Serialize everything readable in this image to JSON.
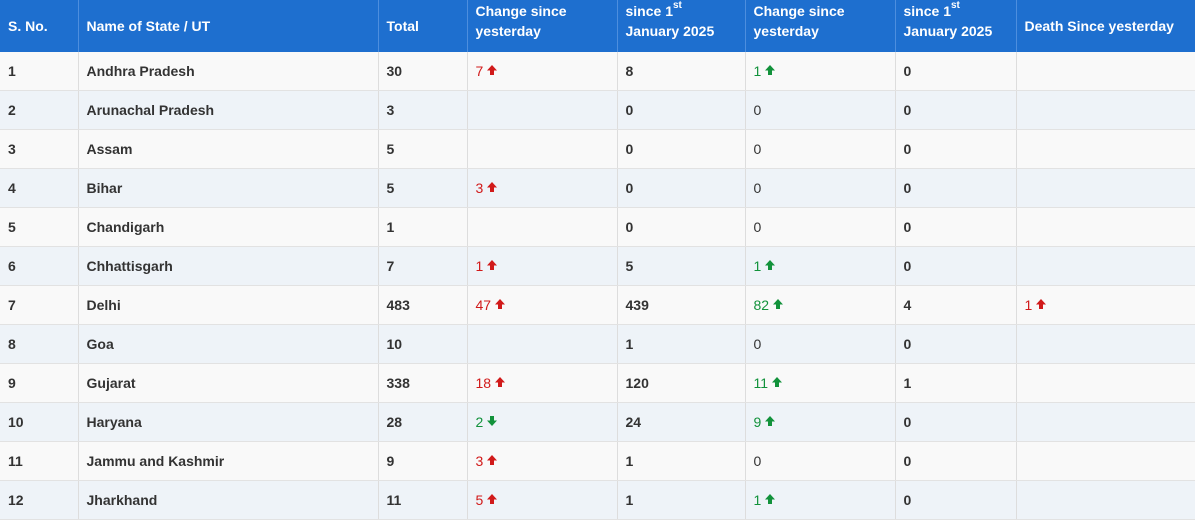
{
  "headers": {
    "sno": "S. No.",
    "name": "Name of State / UT",
    "total": "Total",
    "change1_a": "Change since",
    "change1_b": "yesterday",
    "since1_a": "since 1",
    "since1_sup": "st",
    "since1_b": "January 2025",
    "change2_a": "Change since",
    "change2_b": "yesterday",
    "since2_a": "since 1",
    "since2_sup": "st",
    "since2_b": "January 2025",
    "death": "Death Since yesterday"
  },
  "colors": {
    "header_bg": "#1e6fcf",
    "up_red": "#d11a1a",
    "green": "#12923b"
  },
  "rows": [
    {
      "sno": "1",
      "name": "Andhra Pradesh",
      "total": "30",
      "change1": "7",
      "change1_dir": "up",
      "since1": "8",
      "change2": "1",
      "change2_dir": "up",
      "since2": "0",
      "death": ""
    },
    {
      "sno": "2",
      "name": "Arunachal Pradesh",
      "total": "3",
      "change1": "",
      "change1_dir": "",
      "since1": "0",
      "change2": "0",
      "change2_dir": "",
      "since2": "0",
      "death": ""
    },
    {
      "sno": "3",
      "name": "Assam",
      "total": "5",
      "change1": "",
      "change1_dir": "",
      "since1": "0",
      "change2": "0",
      "change2_dir": "",
      "since2": "0",
      "death": ""
    },
    {
      "sno": "4",
      "name": "Bihar",
      "total": "5",
      "change1": "3",
      "change1_dir": "up",
      "since1": "0",
      "change2": "0",
      "change2_dir": "",
      "since2": "0",
      "death": ""
    },
    {
      "sno": "5",
      "name": "Chandigarh",
      "total": "1",
      "change1": "",
      "change1_dir": "",
      "since1": "0",
      "change2": "0",
      "change2_dir": "",
      "since2": "0",
      "death": ""
    },
    {
      "sno": "6",
      "name": "Chhattisgarh",
      "total": "7",
      "change1": "1",
      "change1_dir": "up",
      "since1": "5",
      "change2": "1",
      "change2_dir": "up",
      "since2": "0",
      "death": ""
    },
    {
      "sno": "7",
      "name": "Delhi",
      "total": "483",
      "change1": "47",
      "change1_dir": "up",
      "since1": "439",
      "change2": "82",
      "change2_dir": "up",
      "since2": "4",
      "death": "1",
      "death_dir": "up"
    },
    {
      "sno": "8",
      "name": "Goa",
      "total": "10",
      "change1": "",
      "change1_dir": "",
      "since1": "1",
      "change2": "0",
      "change2_dir": "",
      "since2": "0",
      "death": ""
    },
    {
      "sno": "9",
      "name": "Gujarat",
      "total": "338",
      "change1": "18",
      "change1_dir": "up",
      "since1": "120",
      "change2": "11",
      "change2_dir": "up",
      "since2": "1",
      "death": ""
    },
    {
      "sno": "10",
      "name": "Haryana",
      "total": "28",
      "change1": "2",
      "change1_dir": "down",
      "since1": "24",
      "change2": "9",
      "change2_dir": "up",
      "since2": "0",
      "death": ""
    },
    {
      "sno": "11",
      "name": "Jammu and Kashmir",
      "total": "9",
      "change1": "3",
      "change1_dir": "up",
      "since1": "1",
      "change2": "0",
      "change2_dir": "",
      "since2": "0",
      "death": ""
    },
    {
      "sno": "12",
      "name": "Jharkhand",
      "total": "11",
      "change1": "5",
      "change1_dir": "up",
      "since1": "1",
      "change2": "1",
      "change2_dir": "up",
      "since2": "0",
      "death": ""
    }
  ]
}
